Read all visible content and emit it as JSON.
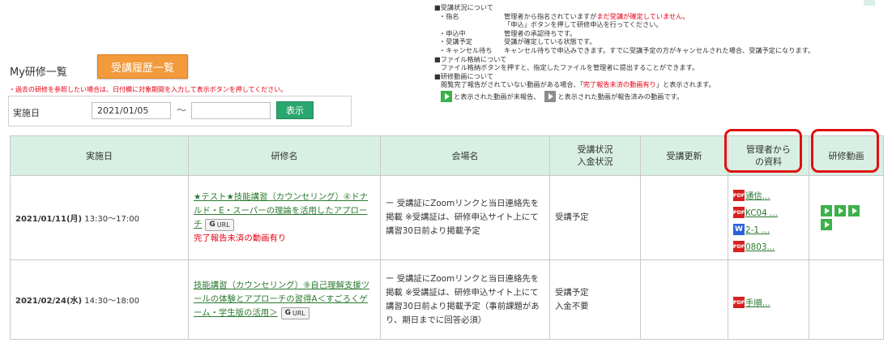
{
  "header": {
    "title": "My研修一覧",
    "history_button": "受講履歴一覧",
    "hint": "・過去の研修を参照したい場合は、日付欄に対象期間を入力して表示ボタンを押してください。"
  },
  "search": {
    "label": "実施日",
    "from_value": "2021/01/05",
    "tilde": "〜",
    "to_value": "",
    "show_button": "表示"
  },
  "notes": {
    "status_heading": "■受講状況について",
    "items": [
      {
        "key": "・指名",
        "lines": [
          "管理者から指名されていますが",
          "まだ受講が確定していません。",
          "「申込」ボタンを押して研修申込を行ってください。"
        ]
      },
      {
        "key": "・申込中",
        "text": "管理者の承認待ちです。"
      },
      {
        "key": "・受講予定",
        "text": "受講が確定している状態です。"
      },
      {
        "key": "・キャンセル待ち",
        "text": "キャンセル待ちで申込みできます。すでに受講予定の方がキャンセルされた場合、受講予定になります。"
      }
    ],
    "file_heading": "■ファイル格納について",
    "file_text": "ファイル格納ボタンを押すと、指定したファイルを管理者に提出することができます。",
    "video_heading": "■研修動画について",
    "video_text_1": "閲覧完了報告がされていない動画がある場合、「",
    "video_text_red": "完了報告未済の動画有り",
    "video_text_2": "」と表示されます。",
    "video_legend_1": "と表示された動画が未報告、",
    "video_legend_2": "と表示された動画が報告済みの動画です。"
  },
  "table": {
    "headers": {
      "date": "実施日",
      "course": "研修名",
      "venue": "会場名",
      "status_1": "受講状況",
      "status_2": "入金状況",
      "update": "受講更新",
      "materials_1": "管理者から",
      "materials_2": "の資料",
      "videos": "研修動画"
    },
    "rows": [
      {
        "date": "2021/01/11(月)",
        "time": "13:30〜17:00",
        "course": "★テスト★技能講習（カウンセリング）④ドナルド・E・スーパーの理論を活用したアプローチ",
        "url_label": "URL",
        "warning": "完了報告未済の動画有り",
        "venue": "ー 受講証にZoomリンクと当日連絡先を掲載 ※受講証は、研修申込サイト上にて講習30日前より掲載予定",
        "status": "受講予定",
        "payment": "",
        "files": [
          {
            "type": "PDF",
            "name": "通信..."
          },
          {
            "type": "PDF",
            "name": "KC04 ..."
          },
          {
            "type": "W",
            "name": "2-1 ..."
          },
          {
            "type": "PDF",
            "name": "0803..."
          }
        ],
        "video_count": 4
      },
      {
        "date": "2021/02/24(水)",
        "time": "14:30〜18:00",
        "course": "技能講習（カウンセリング）⑨自己理解支援ツールの体験とアプローチの習得A＜すごろくゲーム・学生版の活用＞",
        "url_label": "URL",
        "warning": "",
        "venue": "ー 受講証にZoomリンクと当日連絡先を掲載 ※受講証は、研修申込サイト上にて講習30日前より掲載予定（事前課題があり、期日までに回答必須）",
        "status": "受講予定",
        "payment": "入金不要",
        "files": [
          {
            "type": "PDF",
            "name": "手順..."
          }
        ],
        "video_count": 0
      }
    ]
  },
  "colors": {
    "accent_orange": "#f29a3c",
    "green_button": "#2aa66f",
    "header_bg": "#d8f0e3",
    "link_green": "#2a7a2f",
    "alert_red": "#e60012"
  }
}
